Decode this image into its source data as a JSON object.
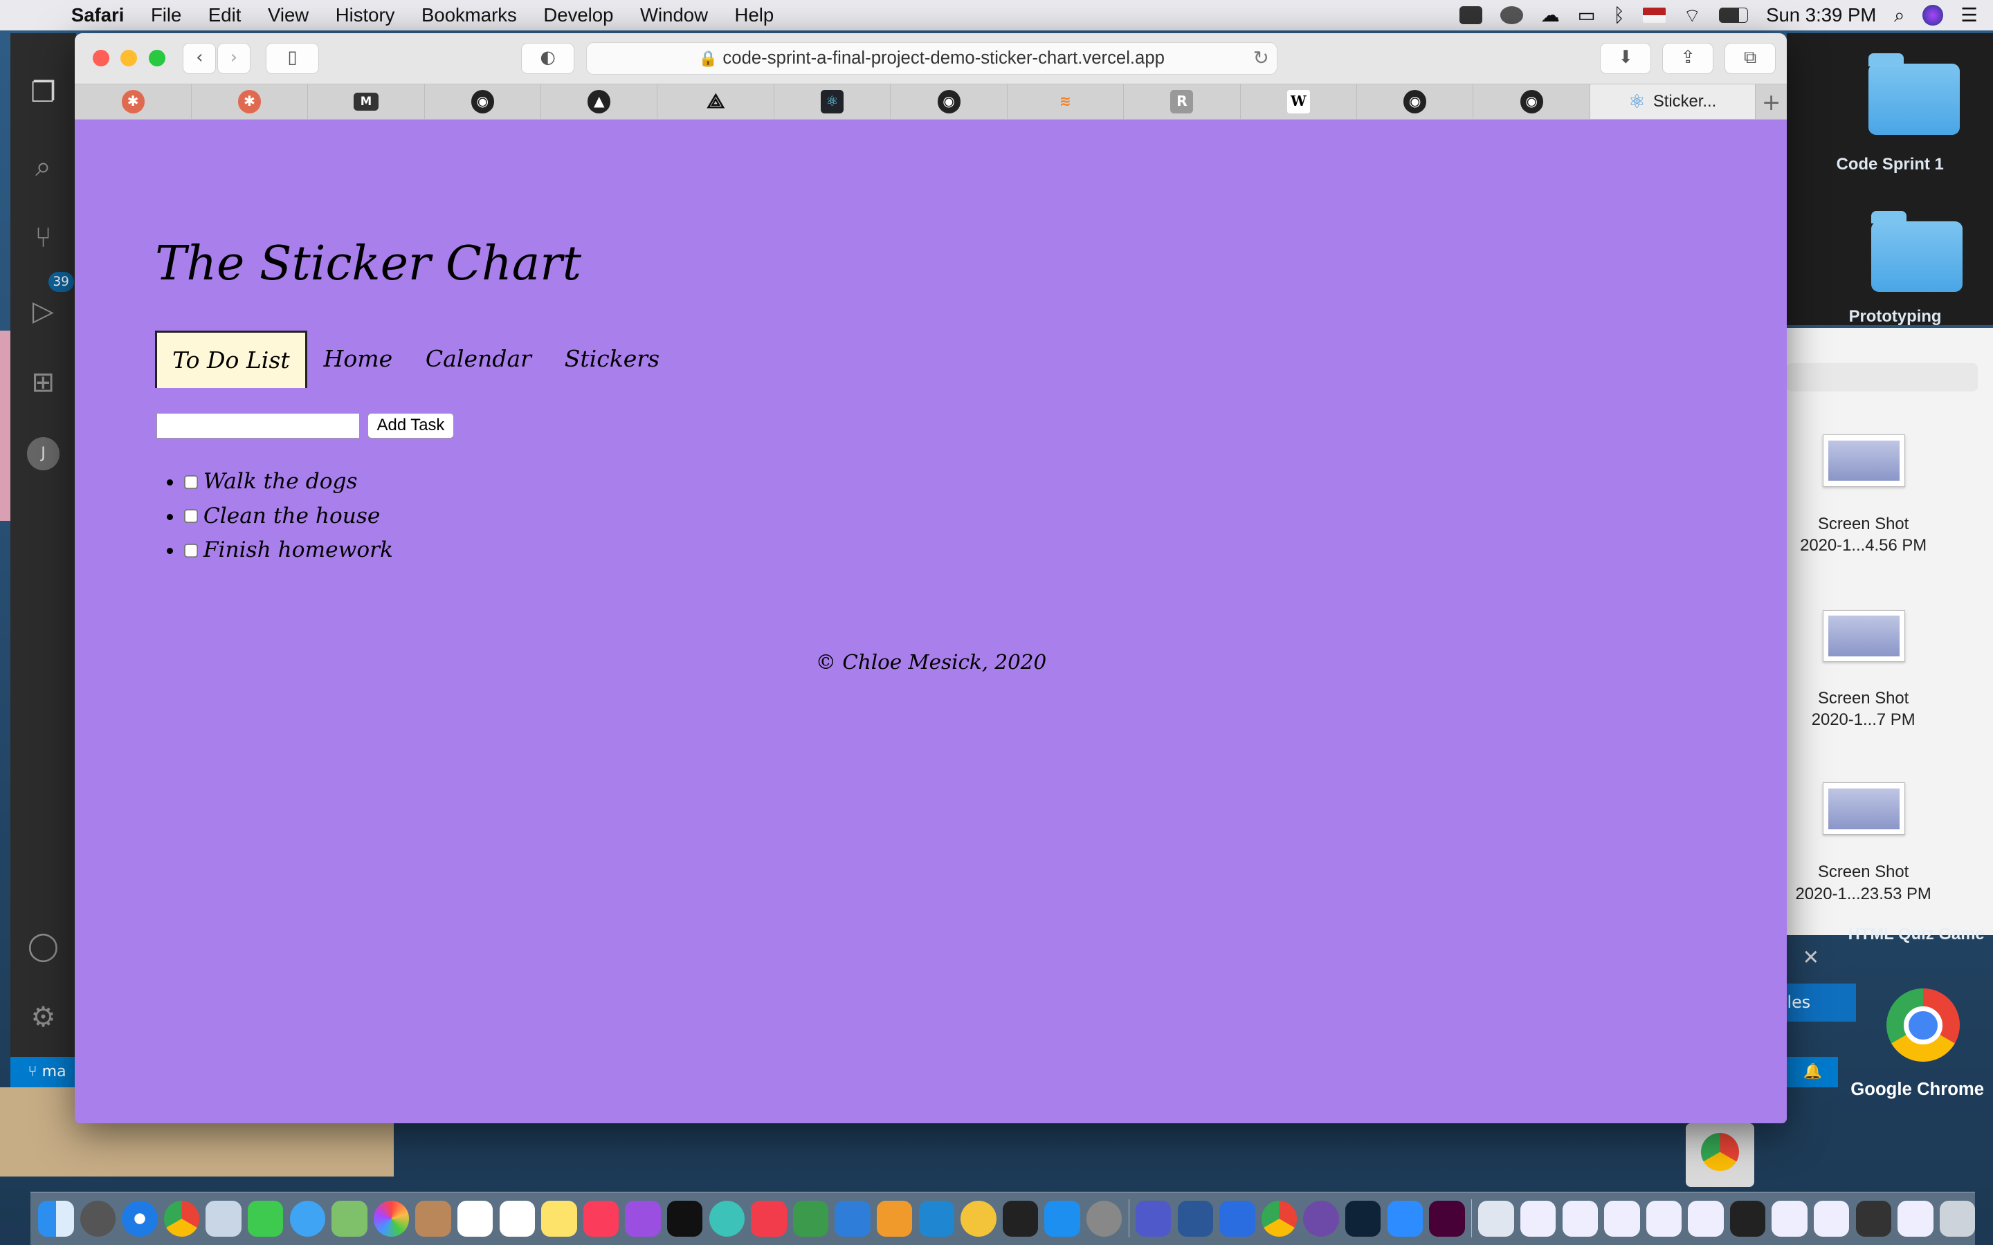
{
  "menubar": {
    "app": "Safari",
    "items": [
      "File",
      "Edit",
      "View",
      "History",
      "Bookmarks",
      "Develop",
      "Window",
      "Help"
    ],
    "clock": "Sun 3:39 PM"
  },
  "vscode": {
    "badge": "39",
    "status": "ma"
  },
  "browser": {
    "url": "code-sprint-a-final-project-demo-sticker-chart.vercel.app",
    "active_tab": "Sticker...",
    "new_tab": "+"
  },
  "page": {
    "title": "The Sticker Chart",
    "nav": [
      "To Do List",
      "Home",
      "Calendar",
      "Stickers"
    ],
    "add_button": "Add Task",
    "input_value": "",
    "tasks": [
      "Walk the dogs",
      "Clean the house",
      "Finish homework"
    ],
    "footer": "© Chloe Mesick, 2020"
  },
  "desktop": {
    "folder1": "Code Sprint 1",
    "folder2": "Prototyping",
    "screenshots": [
      {
        "line1": "Screen Shot",
        "line2": "2020-1...4.56 PM"
      },
      {
        "line1": "Screen Shot",
        "line2": "2020-1...7 PM"
      },
      {
        "line1": "Screen Shot",
        "line2": "2020-1...23.53 PM"
      }
    ],
    "quiz_title": "HTML Quiz Game",
    "quiz_button": "les",
    "chrome_label": "Google Chrome"
  }
}
